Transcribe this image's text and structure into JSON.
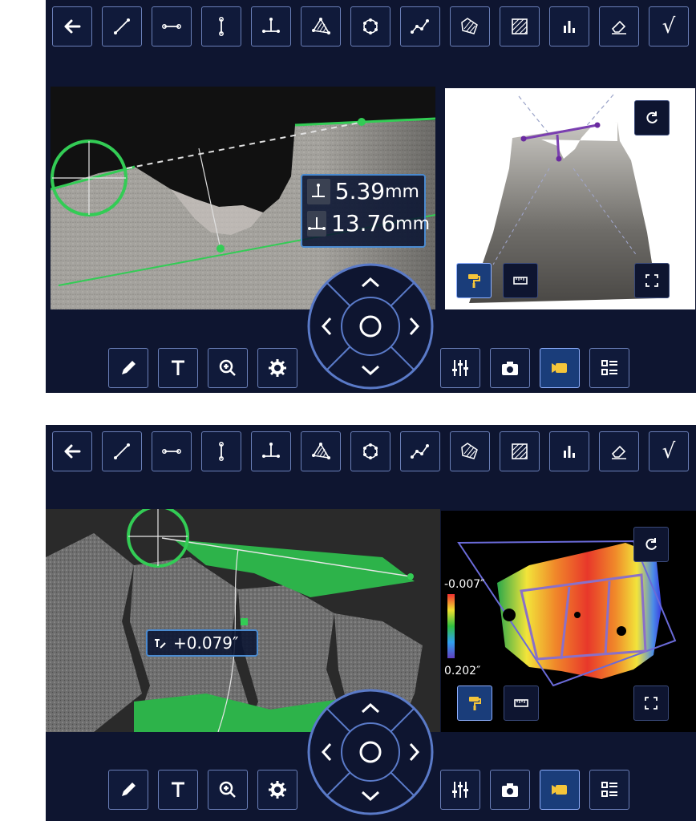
{
  "toolbar_icons": [
    "back-arrow-icon",
    "point-to-point-icon",
    "length-icon",
    "depth-icon",
    "depth-profile-icon",
    "area-icon",
    "circle-gauge-icon",
    "multi-segment-icon",
    "area-depth-icon",
    "hatched-area-icon",
    "bar-chart-icon",
    "eraser-icon",
    "checkmark-icon"
  ],
  "toolbar": {
    "check_label": "√"
  },
  "panel1": {
    "readout": {
      "depth_value": "5.39",
      "depth_unit": "mm",
      "length_value": "13.76",
      "length_unit": "mm"
    }
  },
  "panel2": {
    "readout": {
      "value": "+0.079″"
    },
    "legend": {
      "top": "-0.007″",
      "bottom": "0.202″"
    }
  },
  "bottom_left_icons": [
    "pencil-icon",
    "text-icon",
    "zoom-icon",
    "settings-gear-icon"
  ],
  "bottom_right_icons": [
    "adjust-sliders-icon",
    "camera-icon",
    "video-record-icon",
    "menu-list-icon"
  ],
  "colors": {
    "accent": "#6a7fb8",
    "panel_bg": "#0e1530",
    "green": "#33cc55",
    "active": "#1a3d7a"
  }
}
